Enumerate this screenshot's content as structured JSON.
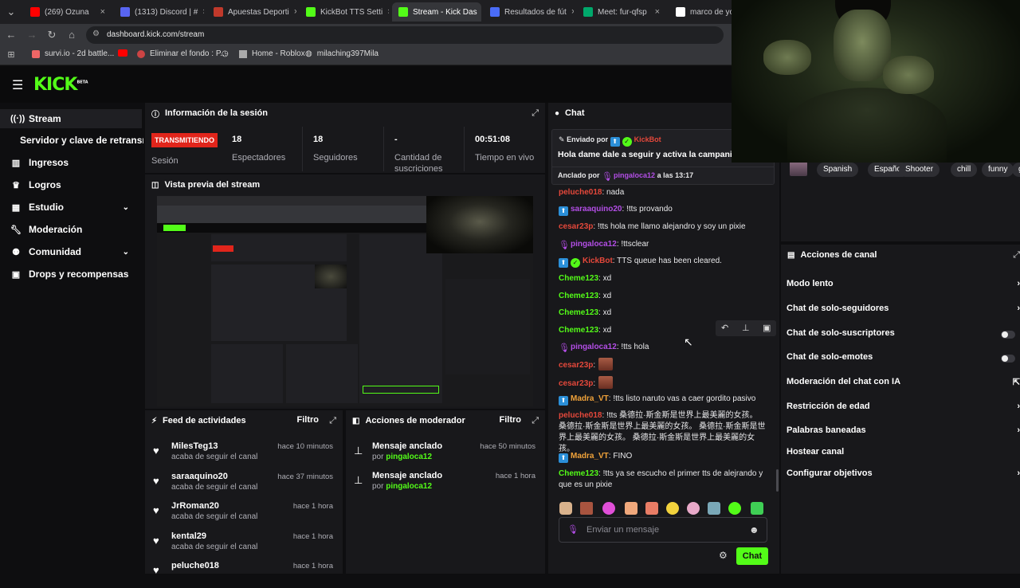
{
  "browser": {
    "tabs": [
      {
        "label": "(269) Ozuna",
        "color": "#ff0000"
      },
      {
        "label": "(1313) Discord | #",
        "color": "#5865f2"
      },
      {
        "label": "Apuestas Deporti",
        "color": "#c0392b"
      },
      {
        "label": "KickBot TTS Setti",
        "color": "#53fc18"
      },
      {
        "label": "Stream - Kick Das",
        "color": "#53fc18"
      },
      {
        "label": "Resultados de fút",
        "color": "#4a6cf7"
      },
      {
        "label": "Meet: fur-qfsp",
        "color": "#00a86b"
      },
      {
        "label": "marco de youtu",
        "color": "#ffffff"
      }
    ],
    "url": "dashboard.kick.com/stream",
    "bookmarks": [
      "survi.io - 2d battle...",
      "",
      "Eliminar el fondo : P...",
      "",
      "Home - Roblox",
      "milaching397Mila"
    ]
  },
  "sidebar": {
    "items": [
      {
        "label": "Stream",
        "icon": "broadcast-icon"
      },
      {
        "label": "Servidor y clave de retransmisión",
        "icon": ""
      },
      {
        "label": "Ingresos",
        "icon": "chart-icon"
      },
      {
        "label": "Logros",
        "icon": "trophy-icon"
      },
      {
        "label": "Estudio",
        "icon": "grid-icon"
      },
      {
        "label": "Moderación",
        "icon": "wrench-icon"
      },
      {
        "label": "Comunidad",
        "icon": "people-icon"
      },
      {
        "label": "Drops y recompensas",
        "icon": "gift-icon"
      }
    ]
  },
  "session": {
    "title": "Información de la sesión",
    "status": "TRANSMITIENDO",
    "session_label": "Sesión",
    "viewers": "18",
    "viewers_label": "Espectadores",
    "followers": "18",
    "followers_label": "Seguidores",
    "subs": "-",
    "subs_label": "Cantidad de suscriciones",
    "time": "00:51:08",
    "time_label": "Tiempo en vivo"
  },
  "preview": {
    "title": "Vista previa del stream"
  },
  "feed": {
    "title": "Feed de actividades",
    "filter": "Filtro",
    "items": [
      {
        "name": "MilesTeg13",
        "sub": "acaba de seguir el canal",
        "time": "hace 10 minutos"
      },
      {
        "name": "saraaquino20",
        "sub": "acaba de seguir el canal",
        "time": "hace 37 minutos"
      },
      {
        "name": "JrRoman20",
        "sub": "acaba de seguir el canal",
        "time": "hace 1 hora"
      },
      {
        "name": "kental29",
        "sub": "acaba de seguir el canal",
        "time": "hace 1 hora"
      },
      {
        "name": "peluche018",
        "sub": "",
        "time": "hace 1 hora"
      }
    ]
  },
  "modactions": {
    "title": "Acciones de moderador",
    "filter": "Filtro",
    "items": [
      {
        "name": "Mensaje anclado",
        "by": "por",
        "user": "pingaloca12",
        "time": "hace 50 minutos"
      },
      {
        "name": "Mensaje anclado",
        "by": "por",
        "user": "pingaloca12",
        "time": "hace 1 hora"
      }
    ]
  },
  "chat": {
    "title": "Chat",
    "pinned_sent_by": "Enviado por",
    "pinned_author": "KickBot",
    "pinned_text": "Hola dame dale a seguir y activa la campanita",
    "anchored_by": "Anclado por",
    "anchored_user": "pingaloca12",
    "anchored_time": "a las 13:17",
    "messages": [
      {
        "user": "peluche018",
        "text": ": nada"
      },
      {
        "user": "saraaquino20",
        "text": ": !tts provando"
      },
      {
        "user": "cesar23p",
        "text": ": !tts hola me llamo alejandro y soy un pixie"
      },
      {
        "user": "pingaloca12",
        "text": ": !ttsclear"
      },
      {
        "user": "KickBot",
        "text": ": TTS queue has been cleared."
      },
      {
        "user": "Cheme123",
        "text": ": xd"
      },
      {
        "user": "Cheme123",
        "text": ": xd"
      },
      {
        "user": "Cheme123",
        "text": ": xd"
      },
      {
        "user": "Cheme123",
        "text": ": xd"
      },
      {
        "user": "pingaloca12",
        "text": ": !tts hola"
      },
      {
        "user": "cesar23p",
        "text": ":"
      },
      {
        "user": "cesar23p",
        "text": ":"
      },
      {
        "user": "Madra_VT",
        "text": ": !tts listo naruto vas a caer gordito pasivo"
      },
      {
        "user": "peluche018",
        "text": ": !tts 桑德拉·斯金斯是世界上最美麗的女孩。 桑德拉·斯金斯是世界上最美麗的女孩。 桑德拉·斯金斯是世界上最美麗的女孩。 桑德拉·斯金斯是世界上最美麗的女孩。"
      },
      {
        "user": "Madra_VT",
        "text": ": FINO"
      },
      {
        "user": "Cheme123",
        "text": ": !tts ya se escucho el primer tts de alejrando y que es un pixie"
      }
    ],
    "input_placeholder": "Enviar un mensaje",
    "send_label": "Chat"
  },
  "stream_info": {
    "tags": [
      "Spanish",
      "Español",
      "Shooter",
      "chill",
      "funny",
      "gam"
    ]
  },
  "channel_actions": {
    "title": "Acciones de canal",
    "rows": [
      {
        "label": "Modo lento",
        "control": "arrow"
      },
      {
        "label": "Chat de solo-seguidores",
        "control": "arrow"
      },
      {
        "label": "Chat de solo-suscriptores",
        "control": "toggle"
      },
      {
        "label": "Chat de solo-emotes",
        "control": "toggle"
      },
      {
        "label": "Moderación del chat con IA",
        "control": "link"
      },
      {
        "label": "Restricción de edad",
        "control": "arrow"
      },
      {
        "label": "Palabras baneadas",
        "control": "arrow"
      },
      {
        "label": "Hostear canal",
        "control": "none"
      },
      {
        "label": "Configurar objetivos",
        "control": "arrow"
      }
    ]
  },
  "colors": {
    "accent": "#53fc18",
    "live": "#e1251b",
    "mod_purple": "#b34ee6",
    "red_user": "#e5483b",
    "orange_user": "#f0a23a"
  }
}
